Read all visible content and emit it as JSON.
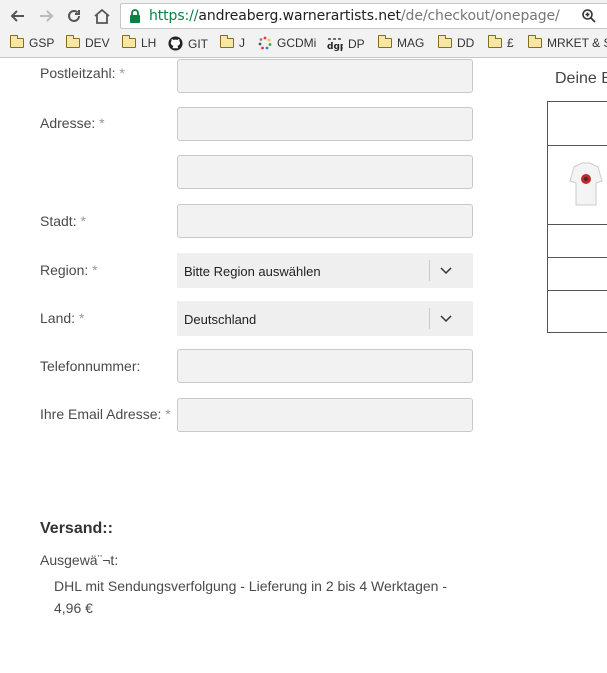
{
  "browser": {
    "url_scheme": "https://",
    "url_host": "andreaberg.warnerartists.net",
    "url_path": "/de/checkout/onepage/",
    "bookmarks": [
      {
        "label": "GSP",
        "icon": "folder-icon"
      },
      {
        "label": "DEV",
        "icon": "folder-icon"
      },
      {
        "label": "LH",
        "icon": "folder-icon"
      },
      {
        "label": "GIT",
        "icon": "github-icon"
      },
      {
        "label": "J",
        "icon": "folder-icon"
      },
      {
        "label": "GCDMi",
        "icon": "spinner-icon"
      },
      {
        "label": "DP",
        "icon": "dgp-icon"
      },
      {
        "label": "MAG",
        "icon": "folder-icon"
      },
      {
        "label": "DD",
        "icon": "folder-icon"
      },
      {
        "label": "£",
        "icon": "folder-icon"
      },
      {
        "label": "MRKET & S",
        "icon": "folder-icon"
      }
    ]
  },
  "form": {
    "postcode_label": "Postleitzahl:",
    "address_label": "Adresse:",
    "city_label": "Stadt:",
    "region_label": "Region:",
    "region_value": "Bitte Region auswählen",
    "country_label": "Land:",
    "country_value": "Deutschland",
    "phone_label": "Telefonnummer:",
    "email_label": "Ihre Email Adresse:",
    "required_mark": "*"
  },
  "shipping": {
    "title": "Versand::",
    "selected_label": "Ausgewä¨¬t:",
    "method": "DHL mit Sendungsverfolgung - Lieferung in 2 bis 4 Werktagen -",
    "price": "4,96 €"
  },
  "summary": {
    "title": "Deine B"
  }
}
